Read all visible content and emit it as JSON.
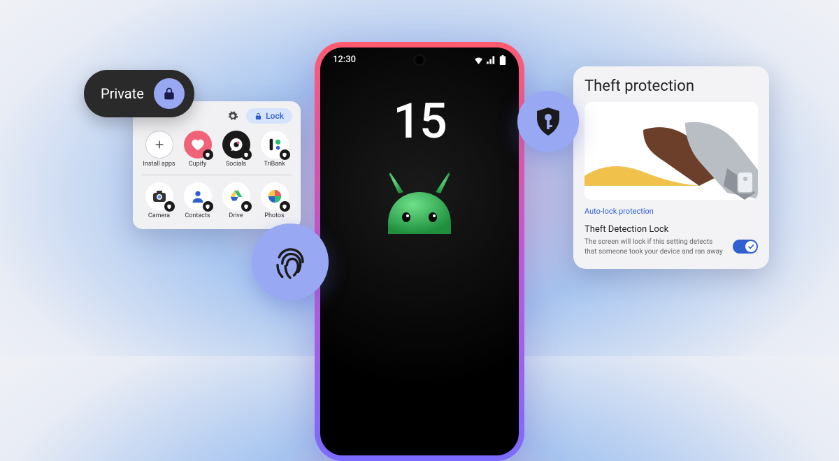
{
  "phone": {
    "time": "12:30",
    "version": "15"
  },
  "private": {
    "label": "Private"
  },
  "apps_panel": {
    "lock_label": "Lock",
    "apps": [
      {
        "name": "Install apps"
      },
      {
        "name": "Cupify"
      },
      {
        "name": "Socials"
      },
      {
        "name": "TriBank"
      },
      {
        "name": "Camera"
      },
      {
        "name": "Contacts"
      },
      {
        "name": "Drive"
      },
      {
        "name": "Photos"
      }
    ]
  },
  "theft": {
    "title": "Theft protection",
    "link": "Auto-lock protection",
    "sub": "Theft Detection Lock",
    "desc": "The screen will lock if this setting detects that someone took your device and ran away"
  }
}
